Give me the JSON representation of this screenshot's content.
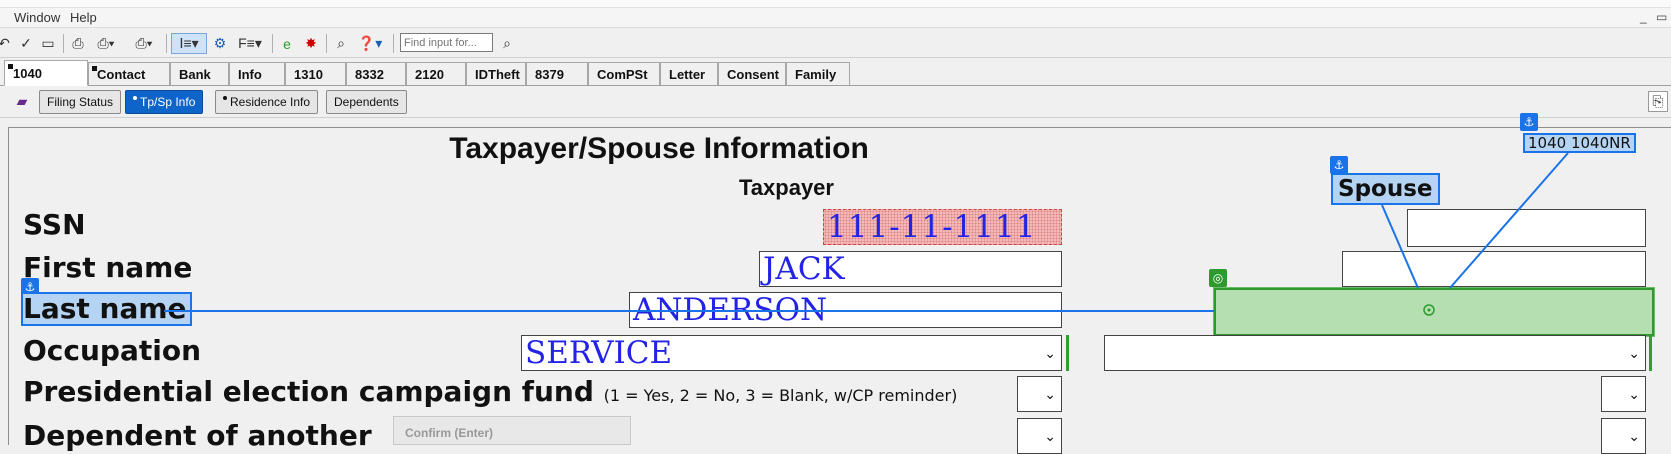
{
  "menu": {
    "window": "Window",
    "help": "Help"
  },
  "toolbar": {
    "find_placeholder": "Find input for..."
  },
  "tabs": [
    "1040",
    "Contact",
    "Bank",
    "Info",
    "1310",
    "8332",
    "2120",
    "IDTheft",
    "8379",
    "ComPSt",
    "Letter",
    "Consent",
    "Family"
  ],
  "subtabs": [
    "Filing Status",
    "Tp/Sp  Info",
    "Residence Info",
    "Dependents"
  ],
  "form": {
    "title": "Taxpayer/Spouse  Information",
    "taxpayer_header": "Taxpayer",
    "spouse_header": "Spouse",
    "tag": "1040  1040NR",
    "labels": {
      "ssn": "SSN",
      "first_name": "First name",
      "last_name": "Last name",
      "occupation": "Occupation",
      "presidential": "Presidential election campaign fund",
      "presidential_note": "(1 = Yes, 2 = No, 3 = Blank, w/CP reminder)",
      "dependent": "Dependent of another"
    },
    "taxpayer": {
      "ssn": "111-11-1111",
      "first_name": "JACK",
      "last_name": "ANDERSON",
      "occupation": "SERVICE"
    },
    "confirm": "Confirm (Enter)"
  },
  "colors": {
    "accent": "#1a73e8",
    "active_subtab": "#0e64c8",
    "green": "#2e9a2e",
    "value_text": "#2323e6"
  }
}
